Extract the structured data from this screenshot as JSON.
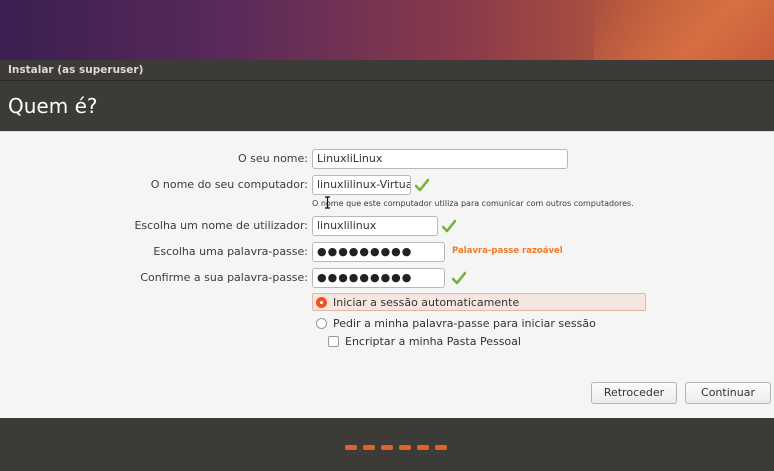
{
  "window": {
    "title": "Instalar (as superuser)"
  },
  "page": {
    "heading": "Quem é?"
  },
  "form": {
    "name": {
      "label": "O seu nome:",
      "value": "LinuxliLinux"
    },
    "computer": {
      "label": "O nome do seu computador:",
      "value": "linuxlilinux-VirtualBo›",
      "hint": "O nome que este computador utiliza para comunicar com outros computadores."
    },
    "username": {
      "label": "Escolha um nome de utilizador:",
      "value": "linuxlilinux"
    },
    "password": {
      "label": "Escolha uma palavra-passe:",
      "value": "●●●●●●●●●",
      "strength": "Palavra-passe razoável"
    },
    "confirm": {
      "label": "Confirme a sua palavra-passe:",
      "value": "●●●●●●●●●"
    }
  },
  "login_options": {
    "auto": "Iniciar a sessão automaticamente",
    "require_password": "Pedir a minha palavra-passe para iniciar sessão",
    "encrypt_home": "Encriptar a minha Pasta Pessoal",
    "selected": "auto"
  },
  "buttons": {
    "back": "Retroceder",
    "continue": "Continuar"
  },
  "colors": {
    "accent": "#e95420",
    "check": "#73b33a",
    "strength": "#f07a28",
    "chrome": "#3c3b37"
  },
  "icons": {
    "valid": "check-icon",
    "progress": "progress-dots"
  },
  "progress": {
    "dots": 6
  }
}
